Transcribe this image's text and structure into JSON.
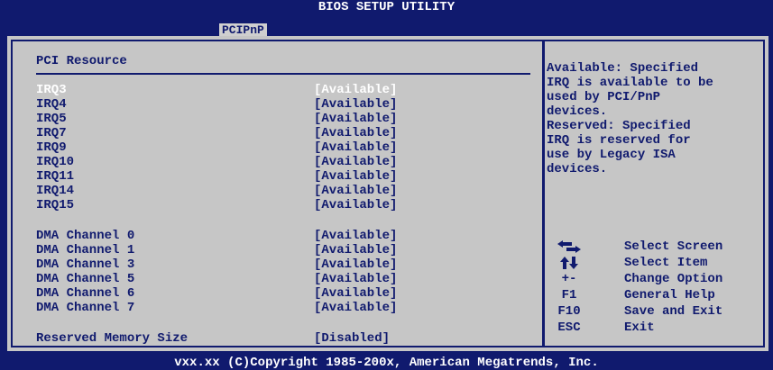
{
  "window": {
    "title": "BIOS SETUP UTILITY"
  },
  "tabs": [
    {
      "label": "PCIPnP",
      "active": true
    }
  ],
  "section_title": "PCI Resource",
  "irq_rows": [
    {
      "label": "IRQ3",
      "value": "[Available]",
      "selected": true
    },
    {
      "label": "IRQ4",
      "value": "[Available]"
    },
    {
      "label": "IRQ5",
      "value": "[Available]"
    },
    {
      "label": "IRQ7",
      "value": "[Available]"
    },
    {
      "label": "IRQ9",
      "value": "[Available]"
    },
    {
      "label": "IRQ10",
      "value": "[Available]"
    },
    {
      "label": "IRQ11",
      "value": "[Available]"
    },
    {
      "label": "IRQ14",
      "value": "[Available]"
    },
    {
      "label": "IRQ15",
      "value": "[Available]"
    }
  ],
  "dma_rows": [
    {
      "label": "DMA Channel 0",
      "value": "[Available]"
    },
    {
      "label": "DMA Channel 1",
      "value": "[Available]"
    },
    {
      "label": "DMA Channel 3",
      "value": "[Available]"
    },
    {
      "label": "DMA Channel 5",
      "value": "[Available]"
    },
    {
      "label": "DMA Channel 6",
      "value": "[Available]"
    },
    {
      "label": "DMA Channel 7",
      "value": "[Available]"
    }
  ],
  "reserved_row": {
    "label": "Reserved Memory Size",
    "value": "[Disabled]"
  },
  "help_lines": [
    "Available: Specified",
    "IRQ is available to be",
    "used by PCI/PnP",
    "devices.",
    "Reserved: Specified",
    "IRQ is reserved for",
    "use by Legacy ISA",
    "devices."
  ],
  "legend": [
    {
      "key": "",
      "icon": "left-right-arrows-icon",
      "desc": "Select Screen"
    },
    {
      "key": "",
      "icon": "up-down-arrows-icon",
      "desc": "Select Item"
    },
    {
      "key": "+-",
      "desc": "Change Option"
    },
    {
      "key": "F1",
      "desc": "General Help"
    },
    {
      "key": "F10",
      "desc": "Save and Exit"
    },
    {
      "key": "ESC",
      "desc": "Exit"
    }
  ],
  "footer": "vxx.xx (C)Copyright 1985-200x, American Megatrends, Inc.",
  "colors": {
    "background": "#101a6e",
    "panel": "#c6c6c6",
    "text": "#101a6e",
    "highlight": "#ffffff"
  }
}
